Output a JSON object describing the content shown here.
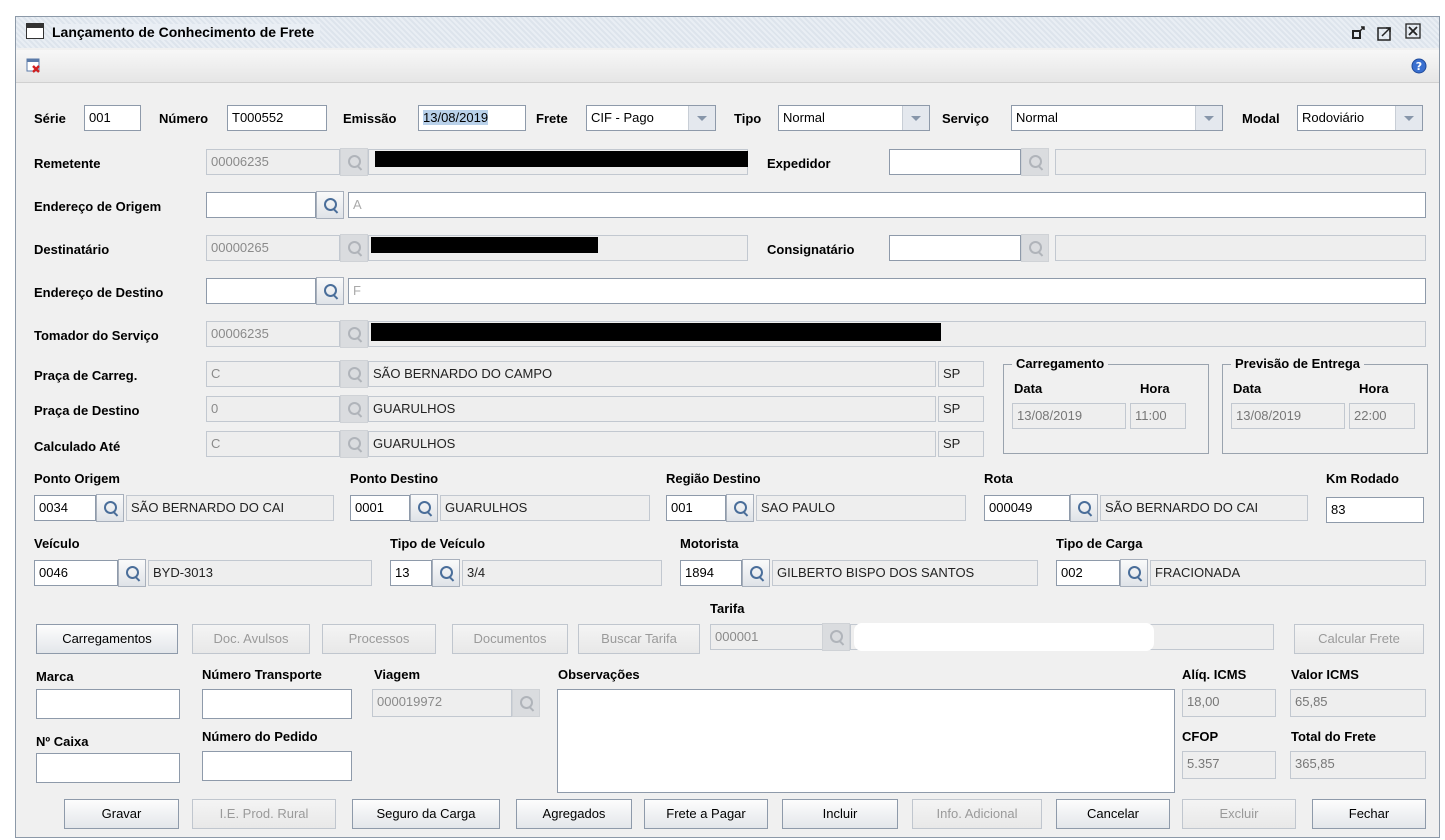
{
  "window": {
    "title": "Lançamento de Conhecimento de Frete"
  },
  "header": {
    "serie_label": "Série",
    "serie": "001",
    "numero_label": "Número",
    "numero": "T000552",
    "emissao_label": "Emissão",
    "emissao": "13/08/2019",
    "frete_label": "Frete",
    "frete": "CIF - Pago",
    "tipo_label": "Tipo",
    "tipo": "Normal",
    "servico_label": "Serviço",
    "servico": "Normal",
    "modal_label": "Modal",
    "modal": "Rodoviário"
  },
  "parties": {
    "remetente_label": "Remetente",
    "remetente_code": "00006235",
    "expedidor_label": "Expedidor",
    "endereco_origem_label": "Endereço de Origem",
    "endereco_origem_text": "A",
    "destinatario_label": "Destinatário",
    "destinatario_code": "00000265",
    "consignatario_label": "Consignatário",
    "endereco_destino_label": "Endereço de Destino",
    "endereco_destino_text": "F",
    "tomador_label": "Tomador do Serviço",
    "tomador_code": "00006235"
  },
  "pracas": {
    "carreg_label": "Praça de Carreg.",
    "carreg_code": "C",
    "carreg_city": "SÃO BERNARDO DO CAMPO",
    "carreg_uf": "SP",
    "destino_label": "Praça de Destino",
    "destino_code": "0",
    "destino_city": "GUARULHOS",
    "destino_uf": "SP",
    "calculado_label": "Calculado Até",
    "calculado_code": "C",
    "calculado_city": "GUARULHOS",
    "calculado_uf": "SP"
  },
  "carregamento": {
    "title": "Carregamento",
    "data_label": "Data",
    "hora_label": "Hora",
    "data": "13/08/2019",
    "hora": "11:00"
  },
  "previsao": {
    "title": "Previsão de Entrega",
    "data_label": "Data",
    "hora_label": "Hora",
    "data": "13/08/2019",
    "hora": "22:00"
  },
  "route": {
    "ponto_origem_label": "Ponto Origem",
    "ponto_origem_code": "0034",
    "ponto_origem_name": "SÃO BERNARDO DO CAI",
    "ponto_destino_label": "Ponto Destino",
    "ponto_destino_code": "0001",
    "ponto_destino_name": "GUARULHOS",
    "regiao_label": "Região Destino",
    "regiao_code": "001",
    "regiao_name": "SAO PAULO",
    "rota_label": "Rota",
    "rota_code": "000049",
    "rota_name": "SÃO BERNARDO DO CAI",
    "km_label": "Km Rodado",
    "km": "83"
  },
  "vehicle": {
    "veiculo_label": "Veículo",
    "veiculo_code": "0046",
    "veiculo_name": "BYD-3013",
    "tipo_veiculo_label": "Tipo de Veículo",
    "tipo_veiculo_code": "13",
    "tipo_veiculo_name": "3/4",
    "motorista_label": "Motorista",
    "motorista_code": "1894",
    "motorista_name": "GILBERTO BISPO DOS SANTOS",
    "tipo_carga_label": "Tipo de Carga",
    "tipo_carga_code": "002",
    "tipo_carga_name": "FRACIONADA"
  },
  "tarifa": {
    "label": "Tarifa",
    "code": "000001"
  },
  "buttons_mid": {
    "carregamentos": "Carregamentos",
    "doc_avulsos": "Doc. Avulsos",
    "processos": "Processos",
    "documentos": "Documentos",
    "buscar_tarifa": "Buscar Tarifa",
    "calcular_frete": "Calcular Frete"
  },
  "bottom": {
    "marca_label": "Marca",
    "numero_transporte_label": "Número Transporte",
    "viagem_label": "Viagem",
    "viagem": "000019972",
    "observacoes_label": "Observações",
    "caixa_label": "Nº Caixa",
    "numero_pedido_label": "Número do Pedido",
    "aliq_icms_label": "Alíq. ICMS",
    "aliq_icms": "18,00",
    "valor_icms_label": "Valor ICMS",
    "valor_icms": "65,85",
    "cfop_label": "CFOP",
    "cfop": "5.357",
    "total_frete_label": "Total do Frete",
    "total_frete": "365,85"
  },
  "actions": {
    "gravar": "Gravar",
    "ie_prod_rural": "I.E. Prod. Rural",
    "seguro": "Seguro da Carga",
    "agregados": "Agregados",
    "frete_pagar": "Frete a Pagar",
    "incluir": "Incluir",
    "info_adicional": "Info. Adicional",
    "cancelar": "Cancelar",
    "excluir": "Excluir",
    "fechar": "Fechar"
  }
}
